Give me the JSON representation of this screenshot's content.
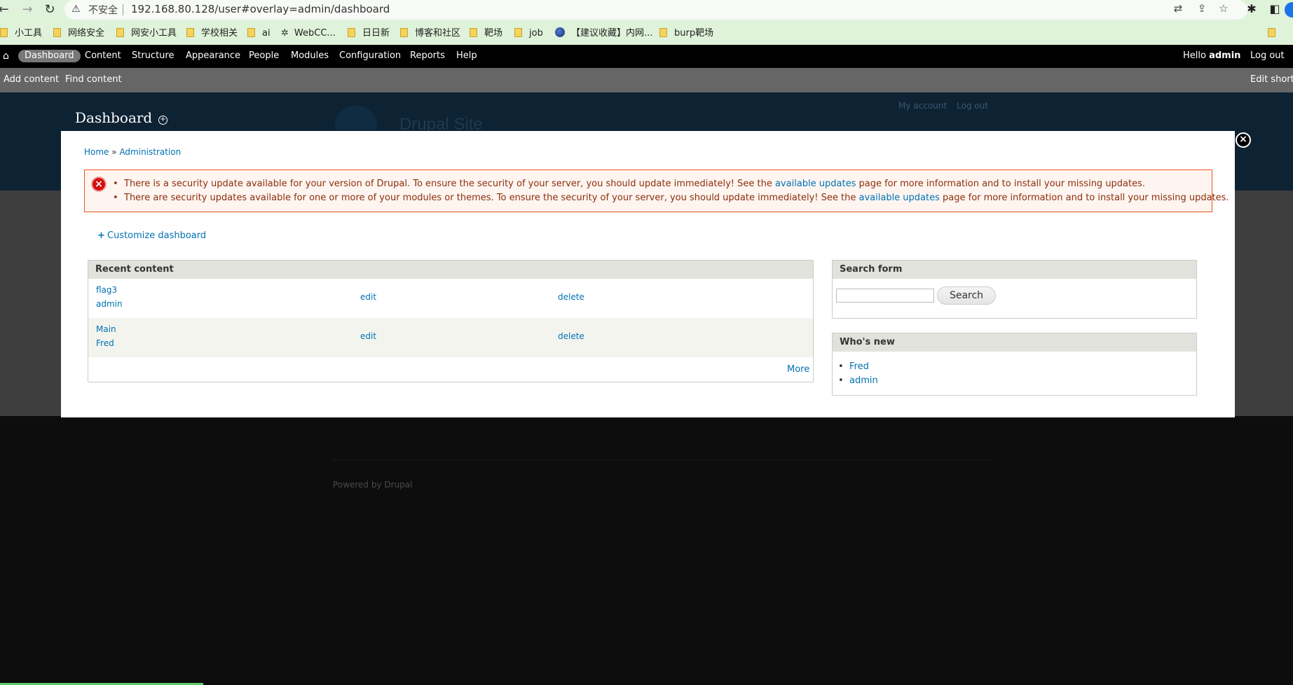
{
  "browser": {
    "insecure_label": "不安全",
    "url": "192.168.80.128/user#overlay=admin/dashboard",
    "bookmarks": [
      "小工具",
      "网络安全",
      "网安小工具",
      "学校相关",
      "ai",
      "WebCC...",
      "日日新",
      "博客和社区",
      "靶场",
      "job",
      "【建议收藏】内网...",
      "burp靶场"
    ]
  },
  "toolbar": {
    "items": [
      "Dashboard",
      "Content",
      "Structure",
      "Appearance",
      "People",
      "Modules",
      "Configuration",
      "Reports",
      "Help"
    ],
    "hello_prefix": "Hello",
    "user": "admin",
    "logout": "Log out"
  },
  "shortcuts": {
    "add_content": "Add content",
    "find_content": "Find content",
    "edit_shortcuts": "Edit shortcuts"
  },
  "page": {
    "title": "Dashboard",
    "site_name": "Drupal Site",
    "my_account": "My account",
    "log_out": "Log out",
    "powered_prefix": "Powered by",
    "powered_link": "Drupal"
  },
  "overlay": {
    "breadcrumb_home": "Home",
    "breadcrumb_sep": "»",
    "breadcrumb_admin": "Administration",
    "messages": [
      {
        "before": "There is a security update available for your version of Drupal. To ensure the security of your server, you should update immediately! See the",
        "link": "available updates",
        "after": "page for more information and to install your missing updates."
      },
      {
        "before": "There are security updates available for one or more of your modules or themes. To ensure the security of your server, you should update immediately! See the",
        "link": "available updates",
        "after": "page for more information and to install your missing updates."
      }
    ],
    "customize": "Customize dashboard",
    "recent": {
      "title": "Recent content",
      "rows": [
        {
          "title": "flag3",
          "author": "admin",
          "edit": "edit",
          "delete": "delete"
        },
        {
          "title": "Main",
          "author": "Fred",
          "edit": "edit",
          "delete": "delete"
        }
      ],
      "more": "More"
    },
    "search": {
      "title": "Search form",
      "button": "Search",
      "value": ""
    },
    "whos_new": {
      "title": "Who's new",
      "users": [
        "Fred",
        "admin"
      ]
    }
  }
}
